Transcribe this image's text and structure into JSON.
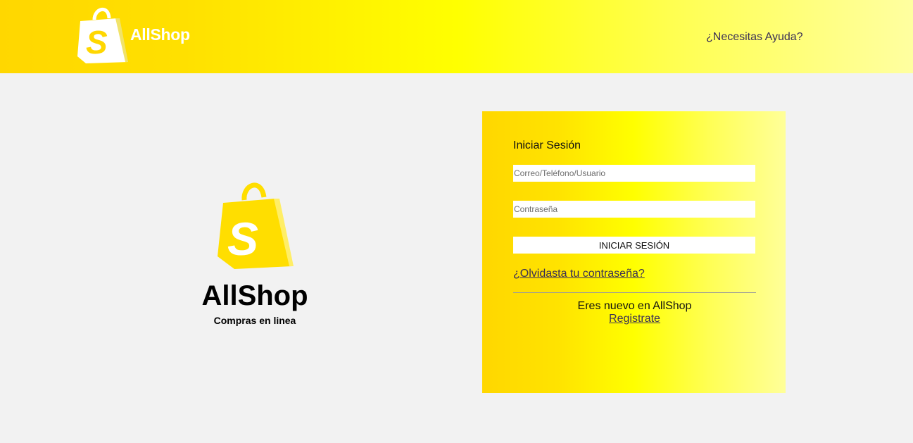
{
  "header": {
    "brand": "AllShop",
    "help_link": "¿Necesitas Ayuda?",
    "logo_icon": "shopping-bag-icon",
    "background_colors": [
      "#ffd700",
      "#ffff00",
      "#ffffa0"
    ]
  },
  "hero": {
    "logo_icon": "shopping-bag-icon",
    "title": "AllShop",
    "subtitle": "Compras en linea",
    "logo_color": "#ffde00"
  },
  "login": {
    "heading": "Iniciar Sesión",
    "user_placeholder": "Correo/Teléfono/Usuario",
    "password_placeholder": "Contraseña",
    "submit_label": "INICIAR SESIÓN",
    "forgot_link": "¿Olvidasta tu contraseña?",
    "new_user_text": "Eres nuevo en AllShop",
    "register_link": "Registrate"
  }
}
